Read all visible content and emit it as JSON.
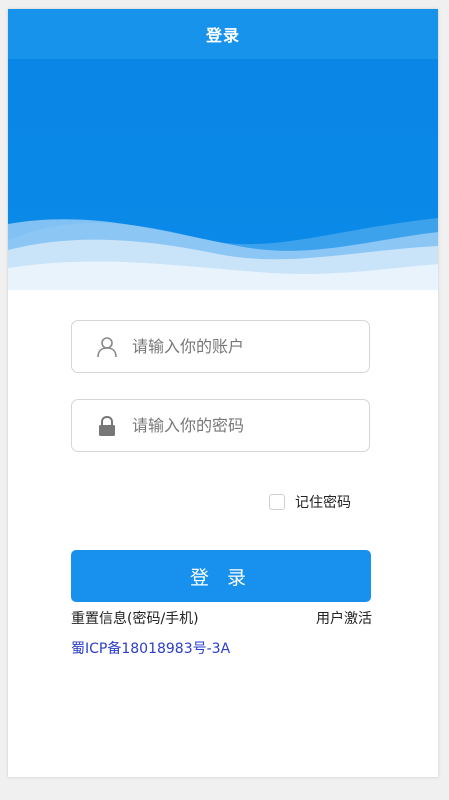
{
  "header": {
    "title": "登录"
  },
  "account": {
    "placeholder": "请输入你的账户",
    "icon": "user-icon"
  },
  "password": {
    "placeholder": "请输入你的密码",
    "icon": "lock-icon"
  },
  "remember": {
    "label": "记住密码",
    "checked": false
  },
  "login_button": {
    "label": "登 录"
  },
  "links": {
    "reset": "重置信息(密码/手机)",
    "activate": "用户激活"
  },
  "footer": {
    "icp": "蜀ICP备18018983号-3A"
  },
  "colors": {
    "primary": "#1893ec",
    "hero": "#0a86e6",
    "link": "#2a3ec9"
  }
}
